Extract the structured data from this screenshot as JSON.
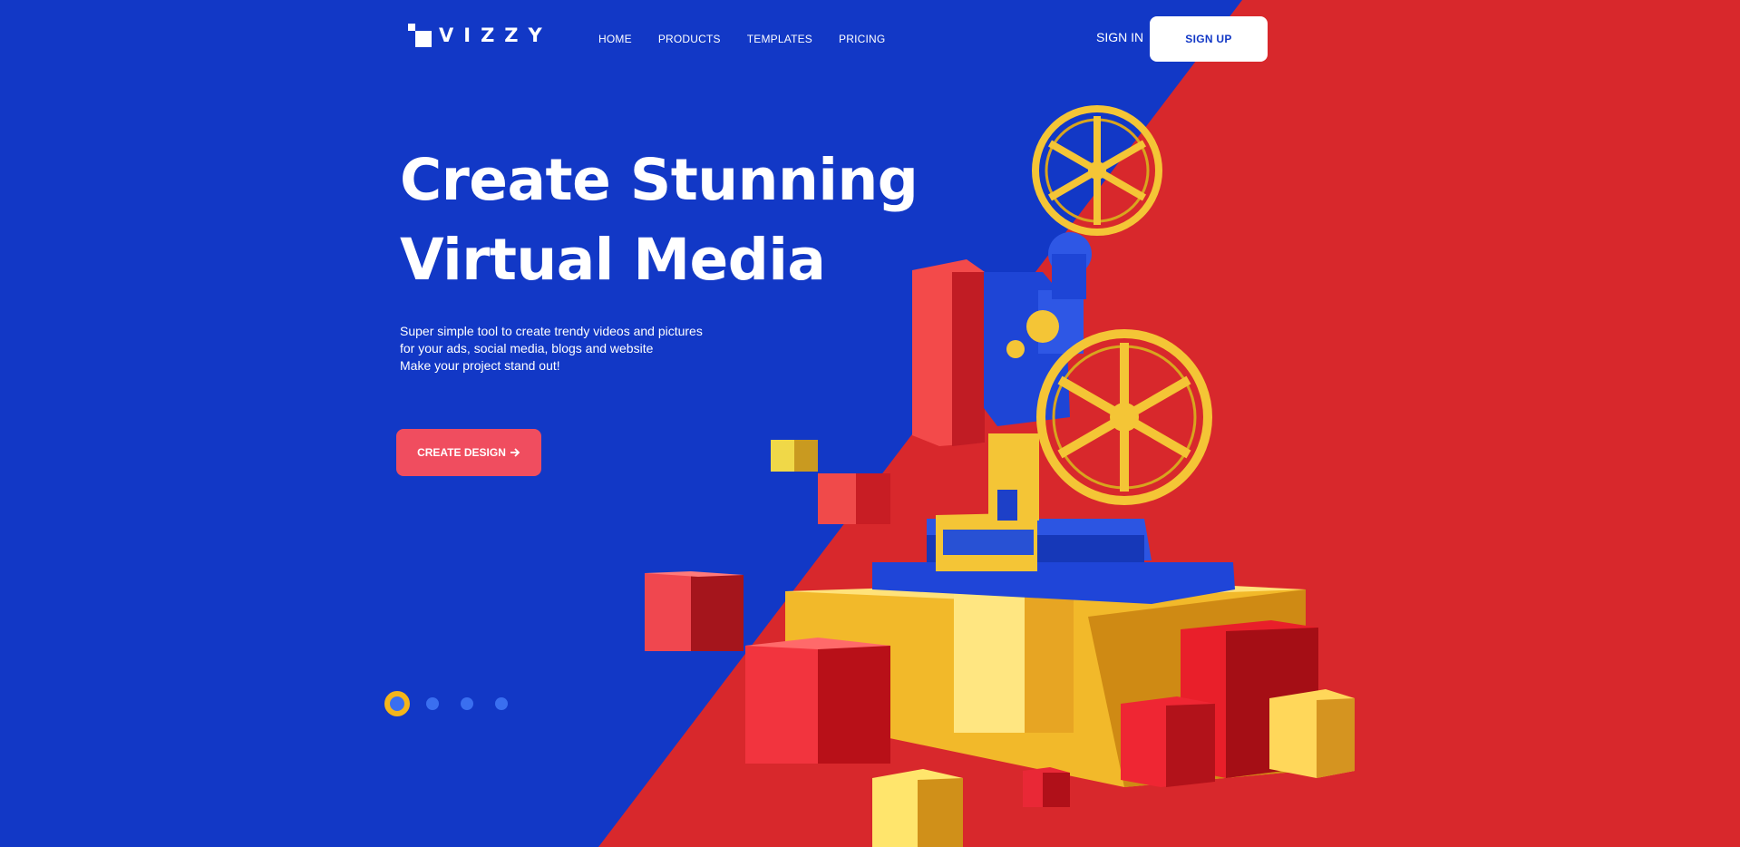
{
  "brand": {
    "name": "VIZZY"
  },
  "nav": {
    "items": [
      {
        "label": "HOME"
      },
      {
        "label": "PRODUCTS"
      },
      {
        "label": "TEMPLATES"
      },
      {
        "label": "PRICING"
      }
    ]
  },
  "auth": {
    "sign_in": "SIGN IN",
    "sign_up": "SIGN UP"
  },
  "hero": {
    "headline_line1": "Create Stunning",
    "headline_line2": "Virtual Media",
    "sub_line1": "Super simple tool to create trendy videos and pictures",
    "sub_line2": "for your ads, social media, blogs and website",
    "sub_line3": "Make your project stand out!",
    "cta_label": "CREATE DESIGN",
    "cta_icon": "arrow-right-icon"
  },
  "slider": {
    "count": 4,
    "active_index": 0
  },
  "colors": {
    "blue": "#1238c6",
    "red": "#d8282c",
    "cta": "#f04d5f",
    "yellow": "#f4b51a",
    "dot": "#3a6ff0"
  },
  "illustration": {
    "subject": "film-projector-on-cubes"
  }
}
